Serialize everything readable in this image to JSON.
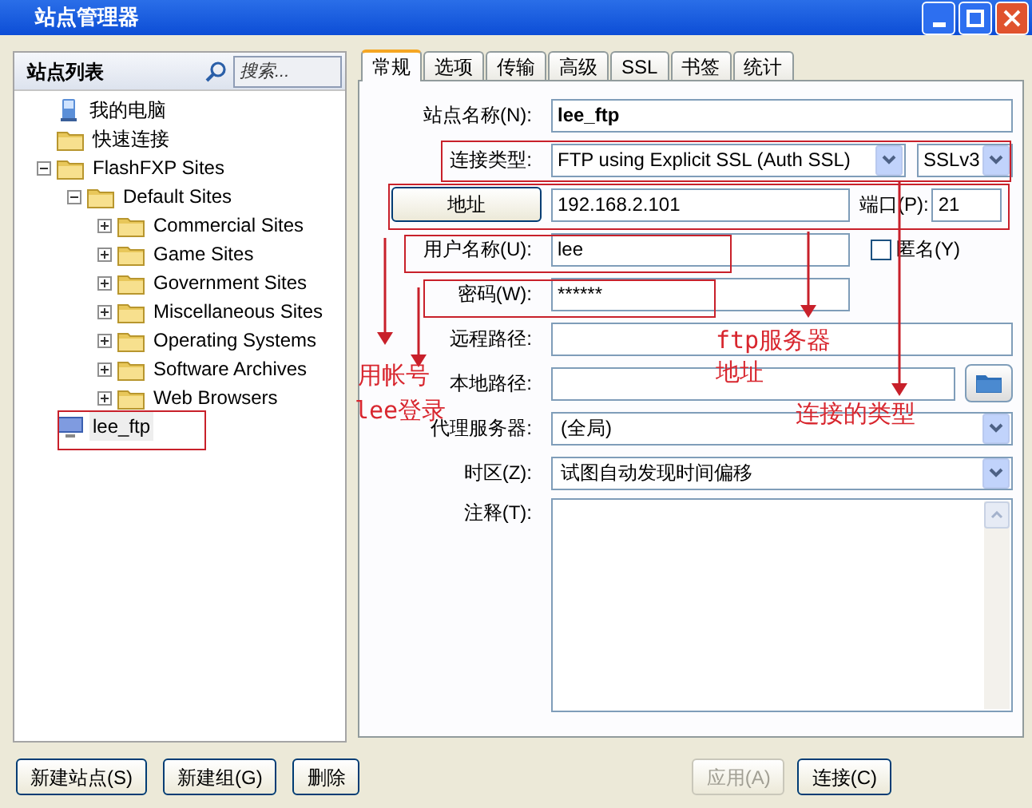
{
  "window": {
    "title": "站点管理器"
  },
  "sidebar": {
    "title": "站点列表",
    "search_placeholder": "搜索...",
    "tree": [
      {
        "kind": "computer",
        "label": "我的电脑",
        "selected": false
      },
      {
        "kind": "folder",
        "label": "快速连接",
        "selected": false
      },
      {
        "kind": "folder",
        "label": "FlashFXP Sites",
        "selected": false,
        "expanded": true,
        "children": [
          {
            "kind": "folder",
            "label": "Default Sites",
            "selected": false,
            "expanded": true,
            "children": [
              {
                "kind": "folder",
                "label": "Commercial Sites",
                "selected": false,
                "expanded": false
              },
              {
                "kind": "folder",
                "label": "Game Sites",
                "selected": false,
                "expanded": false
              },
              {
                "kind": "folder",
                "label": "Government Sites",
                "selected": false,
                "expanded": false
              },
              {
                "kind": "folder",
                "label": "Miscellaneous Sites",
                "selected": false,
                "expanded": false
              },
              {
                "kind": "folder",
                "label": "Operating Systems",
                "selected": false,
                "expanded": false
              },
              {
                "kind": "folder",
                "label": "Software Archives",
                "selected": false,
                "expanded": false
              },
              {
                "kind": "folder",
                "label": "Web Browsers",
                "selected": false,
                "expanded": false
              }
            ]
          }
        ]
      },
      {
        "kind": "site",
        "label": "lee_ftp",
        "selected": true
      }
    ]
  },
  "tabs": [
    {
      "label": "常规",
      "selected": true
    },
    {
      "label": "选项",
      "selected": false
    },
    {
      "label": "传输",
      "selected": false
    },
    {
      "label": "高级",
      "selected": false
    },
    {
      "label": "SSL",
      "selected": false
    },
    {
      "label": "书签",
      "selected": false
    },
    {
      "label": "统计",
      "selected": false
    }
  ],
  "form": {
    "fields": [
      {
        "kind": "name",
        "label": "站点名称(N):",
        "value": "lee_ftp"
      },
      {
        "kind": "select2",
        "label": "连接类型:",
        "value": "FTP using Explicit SSL (Auth SSL)",
        "value2": "SSLv3"
      },
      {
        "kind": "address",
        "button": "地址",
        "value": "192.168.2.101",
        "port_label": "端口(P):",
        "port": "21"
      },
      {
        "kind": "user",
        "label": "用户名称(U):",
        "value": "lee",
        "checkbox": {
          "label": "匿名(Y)",
          "checked": false
        }
      },
      {
        "kind": "short",
        "label": "密码(W):",
        "value": "******"
      },
      {
        "kind": "text",
        "label": "远程路径:"
      },
      {
        "kind": "browse",
        "label": "本地路径:"
      },
      {
        "kind": "select",
        "label": "代理服务器:",
        "value": "(全局)"
      },
      {
        "kind": "select",
        "label": "时区(Z):",
        "value": "试图自动发现时间偏移"
      },
      {
        "kind": "textarea",
        "label": "注释(T):"
      }
    ]
  },
  "buttons_left": [
    {
      "label": "新建站点(S)",
      "disabled": false
    },
    {
      "label": "新建组(G)",
      "disabled": false
    },
    {
      "label": "删除",
      "disabled": false
    }
  ],
  "buttons_right": [
    {
      "label": "应用(A)",
      "disabled": true
    },
    {
      "label": "连接(C)",
      "disabled": false
    }
  ],
  "annotations": {
    "notes": [
      "用帐号",
      "lee登录",
      "ftp服务器",
      "地址",
      "连接的类型"
    ]
  }
}
